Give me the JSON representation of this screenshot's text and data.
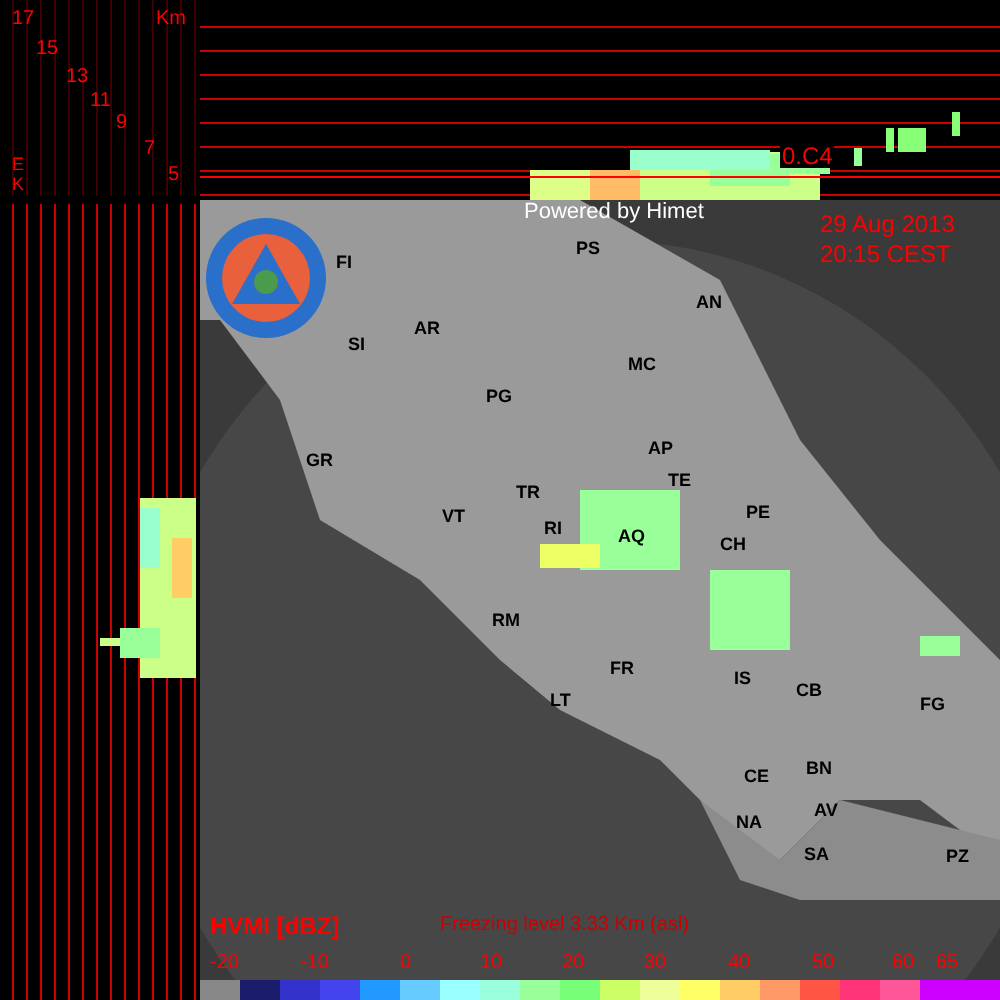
{
  "height_axis": {
    "unit": "Km",
    "ticks": [
      "17",
      "15",
      "13",
      "11",
      "9",
      "7",
      "5"
    ],
    "corner_letters": [
      "E",
      "K"
    ]
  },
  "profile_marker": "0.C4",
  "credit": "Powered by Himet",
  "date": "29 Aug 2013",
  "time": "20:15 CEST",
  "cities": [
    "FI",
    "PS",
    "AN",
    "SI",
    "AR",
    "MC",
    "PG",
    "AP",
    "GR",
    "TE",
    "TR",
    "VT",
    "RI",
    "AQ",
    "PE",
    "CH",
    "RM",
    "FR",
    "IS",
    "CB",
    "FG",
    "LT",
    "CE",
    "BN",
    "AV",
    "NA",
    "SA",
    "PZ"
  ],
  "legend": {
    "title": "HVMI [dBZ]",
    "freezing_level": "Freezing level  3.33 Km (asl)",
    "labels": [
      "-20",
      "-10",
      "0",
      "10",
      "20",
      "30",
      "40",
      "50",
      "60",
      "65"
    ],
    "scale": [
      {
        "color": "#888888"
      },
      {
        "color": "#1c1c6c"
      },
      {
        "color": "#3333cc"
      },
      {
        "color": "#4444ee"
      },
      {
        "color": "#2299ff"
      },
      {
        "color": "#66ccff"
      },
      {
        "color": "#99ffff"
      },
      {
        "color": "#99ffdd"
      },
      {
        "color": "#99ff99"
      },
      {
        "color": "#77ff77"
      },
      {
        "color": "#ccff66"
      },
      {
        "color": "#eeff99"
      },
      {
        "color": "#ffff66"
      },
      {
        "color": "#ffcc66"
      },
      {
        "color": "#ff9966"
      },
      {
        "color": "#ff5544"
      },
      {
        "color": "#ff3377"
      },
      {
        "color": "#ff5599"
      },
      {
        "color": "#cc00ff"
      },
      {
        "color": "#cc00ff"
      }
    ]
  }
}
